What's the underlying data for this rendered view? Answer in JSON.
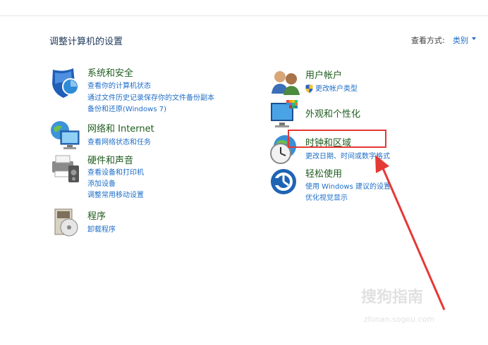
{
  "page_title": "调整计算机的设置",
  "view_by": {
    "label": "查看方式:",
    "value": "类别"
  },
  "left_categories": [
    {
      "heading": "系统和安全",
      "links": [
        "查看你的计算机状态",
        "通过文件历史记录保存你的文件备份副本",
        "备份和还原(Windows 7)"
      ]
    },
    {
      "heading": "网络和 Internet",
      "links": [
        "查看网络状态和任务"
      ]
    },
    {
      "heading": "硬件和声音",
      "links": [
        "查看设备和打印机",
        "添加设备",
        "调整常用移动设置"
      ]
    },
    {
      "heading": "程序",
      "links": [
        "卸载程序"
      ]
    }
  ],
  "right_categories": [
    {
      "heading": "用户帐户",
      "links": [
        "更改帐户类型"
      ]
    },
    {
      "heading": "外观和个性化",
      "links": []
    },
    {
      "heading": "时钟和区域",
      "links": [
        "更改日期、时间或数字格式"
      ]
    },
    {
      "heading": "轻松使用",
      "links": [
        "使用 Windows 建议的设置",
        "优化视觉显示"
      ]
    }
  ],
  "watermark": {
    "text": "搜狗指南",
    "url": "zhinan.sogou.com"
  },
  "colors": {
    "heading": "#1e5c1e",
    "link": "#1e6ec8",
    "title": "#1e395b",
    "annotation": "#e53935"
  }
}
